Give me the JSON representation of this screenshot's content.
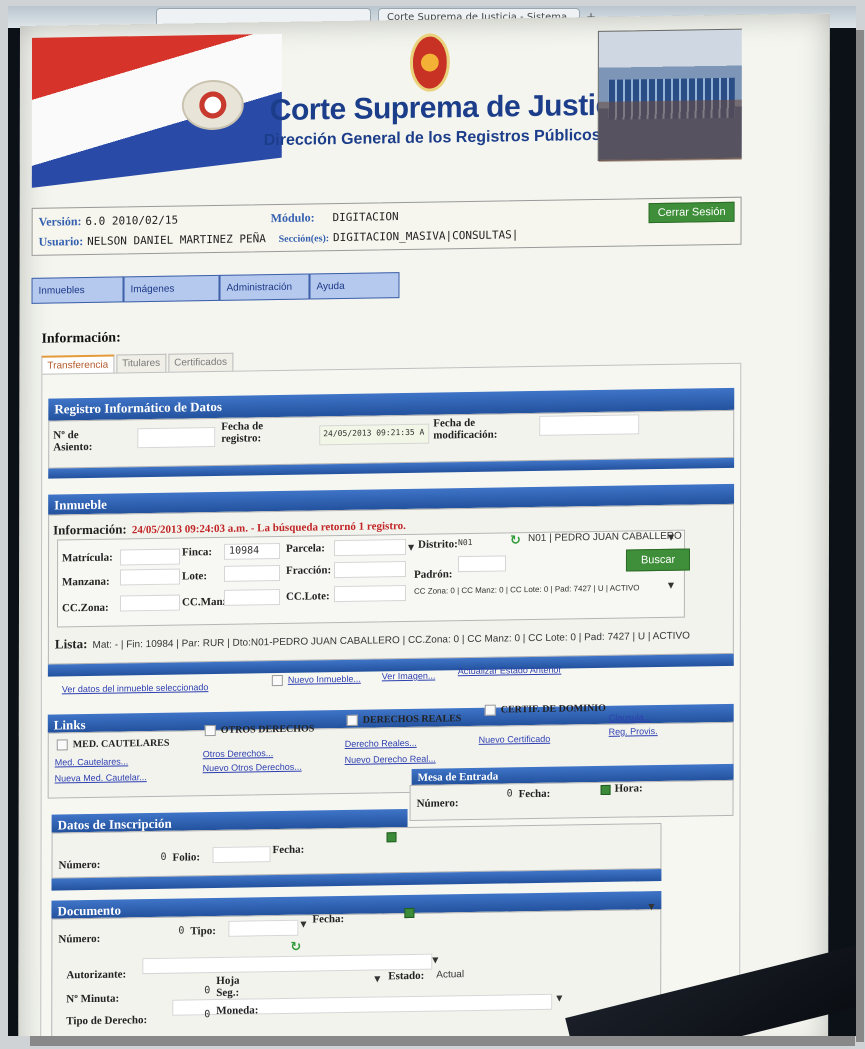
{
  "browser": {
    "tabs": [
      "",
      "Corte Suprema de Justicia - Sistema..."
    ],
    "new_tab_icon": "plus-icon"
  },
  "banner": {
    "title": "Corte Suprema de Justicia",
    "subtitle": "Dirección General de los Registros Públicos"
  },
  "session": {
    "version_label": "Versión:",
    "version_value": "6.0 2010/02/15",
    "user_label": "Usuario:",
    "user_value": "NELSON DANIEL MARTINEZ PEÑA",
    "module_label": "Módulo:",
    "module_value": "DIGITACION",
    "section_label": "Sección(es):",
    "section_value": "DIGITACION_MASIVA|CONSULTAS|",
    "logout": "Cerrar Sesión"
  },
  "menu": [
    "Inmuebles",
    "Imágenes",
    "Administración",
    "Ayuda"
  ],
  "info_heading": "Información:",
  "subtabs": [
    "Transferencia",
    "Titulares",
    "Certificados"
  ],
  "registro": {
    "title": "Registro Informático de Datos",
    "asiento_label": "Nº de Asiento:",
    "fecha_registro_label": "Fecha de registro:",
    "fecha_registro_value": "24/05/2013 09:21:35 A",
    "fecha_mod_label": "Fecha de modificación:"
  },
  "inmueble": {
    "title": "Inmueble",
    "info_label": "Información:",
    "info_message": "24/05/2013 09:24:03 a.m. - La búsqueda retornó 1 registro.",
    "matricula_label": "Matrícula:",
    "finca_label": "Finca:",
    "finca_value": "10984",
    "parcela_label": "Parcela:",
    "distrito_label": "Distrito:",
    "distrito_code": "N01",
    "distrito_value": "N01 | PEDRO JUAN CABALLERO",
    "manzana_label": "Manzana:",
    "lote_label": "Lote:",
    "fraccion_label": "Fracción:",
    "padron_label": "Padrón:",
    "cczona_label": "CC.Zona:",
    "ccmanz_label": "CC.Manz:",
    "cclote_label": "CC.Lote:",
    "result_value": "CC Zona: 0 | CC Manz: 0 | CC Lote: 0 | Pad: 7427 | U | ACTIVO",
    "buscar": "Buscar",
    "lista_label": "Lista:",
    "lista_value": "Mat: - | Fin: 10984 | Par: RUR | Dto:N01-PEDRO JUAN CABALLERO | CC.Zona: 0 | CC Manz: 0 | CC Lote: 0 | Pad: 7427 | U | ACTIVO",
    "link_ver_datos": "Ver datos del inmueble seleccionado",
    "link_nuevo": "Nuevo Inmueble...",
    "link_ver_imagen": "Ver Imagen...",
    "link_actualizar": "Actualizar Estado Anterior"
  },
  "links": {
    "title": "Links",
    "med_cautelares": "MED. CAUTELARES",
    "otros_derechos": "OTROS DERECHOS",
    "derechos_reales": "DERECHOS REALES",
    "certif_dominio": "CERTIF. DE DOMINIO",
    "l_med_cautelares": "Med. Cautelares...",
    "l_nueva_med": "Nueva Med. Cautelar...",
    "l_otros": "Otros Derechos...",
    "l_nuevo_otros": "Nuevo Otros Derechos...",
    "l_derecho_reales": "Derecho Reales...",
    "l_nuevo_derecho": "Nuevo Derecho Real...",
    "l_nuevo_cert": "Nuevo Certificado",
    "l_clausula": "Clausula...",
    "l_reg_provis": "Reg. Provis."
  },
  "mesa": {
    "title": "Mesa de Entrada",
    "numero_label": "Número:",
    "numero_value": "0",
    "fecha_label": "Fecha:",
    "hora_label": "Hora:"
  },
  "inscripcion": {
    "title": "Datos de Inscripción",
    "numero_label": "Número:",
    "numero_value": "0",
    "folio_label": "Folio:",
    "fecha_label": "Fecha:"
  },
  "documento": {
    "title": "Documento",
    "numero_label": "Número:",
    "numero_value": "0",
    "tipo_label": "Tipo:",
    "fecha_label": "Fecha:",
    "autorizante_label": "Autorizante:",
    "tipo_derecho_label": "Tipo de Derecho:",
    "minuta_label": "Nº Minuta:",
    "minuta_value": "0",
    "hoja_label": "Hoja Seg.:",
    "moneda_label": "Moneda:",
    "moneda_value": "0",
    "estado_label": "Estado:",
    "estado_value": "Actual"
  },
  "colors": {
    "bar_blue": "#23529e",
    "accent_green": "#3f8f3a",
    "menu_blue": "#b5c8ee",
    "alert_red": "#c12525"
  }
}
